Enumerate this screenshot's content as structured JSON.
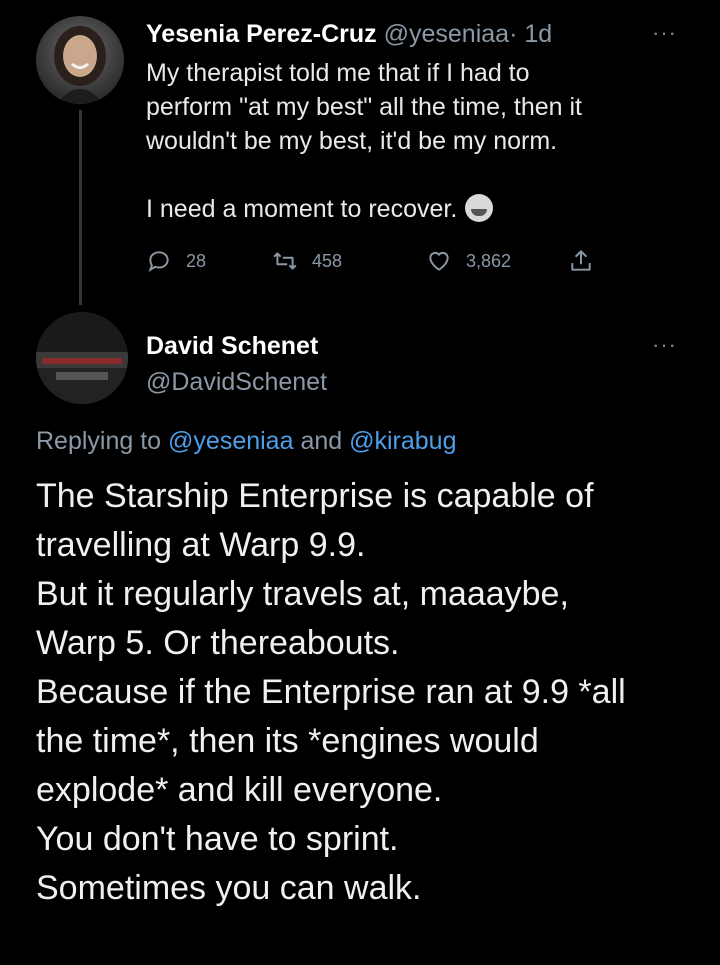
{
  "tweet1": {
    "author_name": "Yesenia Perez-Cruz",
    "author_handle": "@yeseniaa",
    "time": "· 1d",
    "more_label": "···",
    "lines": [
      "My therapist told me that if I had to",
      "perform \"at my best\" all the time, then it",
      "wouldn't be my best, it'd be my norm."
    ],
    "last_line": "I need a moment to recover.",
    "emoji": "laughing-with-tears-emoji",
    "replies": "28",
    "retweets": "458",
    "likes": "3,862"
  },
  "tweet2": {
    "author_name": "David Schenet",
    "author_handle": "@DavidSchenet",
    "more_label": "···",
    "replying_prefix": "Replying to",
    "replying_user1": "@yeseniaa",
    "replying_and": "and",
    "replying_user2": "@kirabug",
    "lines": [
      "The Starship Enterprise is capable of",
      "travelling at Warp 9.9.",
      "But it regularly travels at, maaaybe,",
      "Warp 5. Or thereabouts.",
      "Because if the Enterprise ran at 9.9 *all",
      "the time*, then its *engines would",
      "explode* and kill everyone.",
      "You don't have to sprint.",
      "Sometimes you can walk."
    ]
  },
  "colors": {
    "background": "#000000",
    "text": "#e7e9ea",
    "secondary": "#8b98a5",
    "link": "#4f9ee8"
  }
}
